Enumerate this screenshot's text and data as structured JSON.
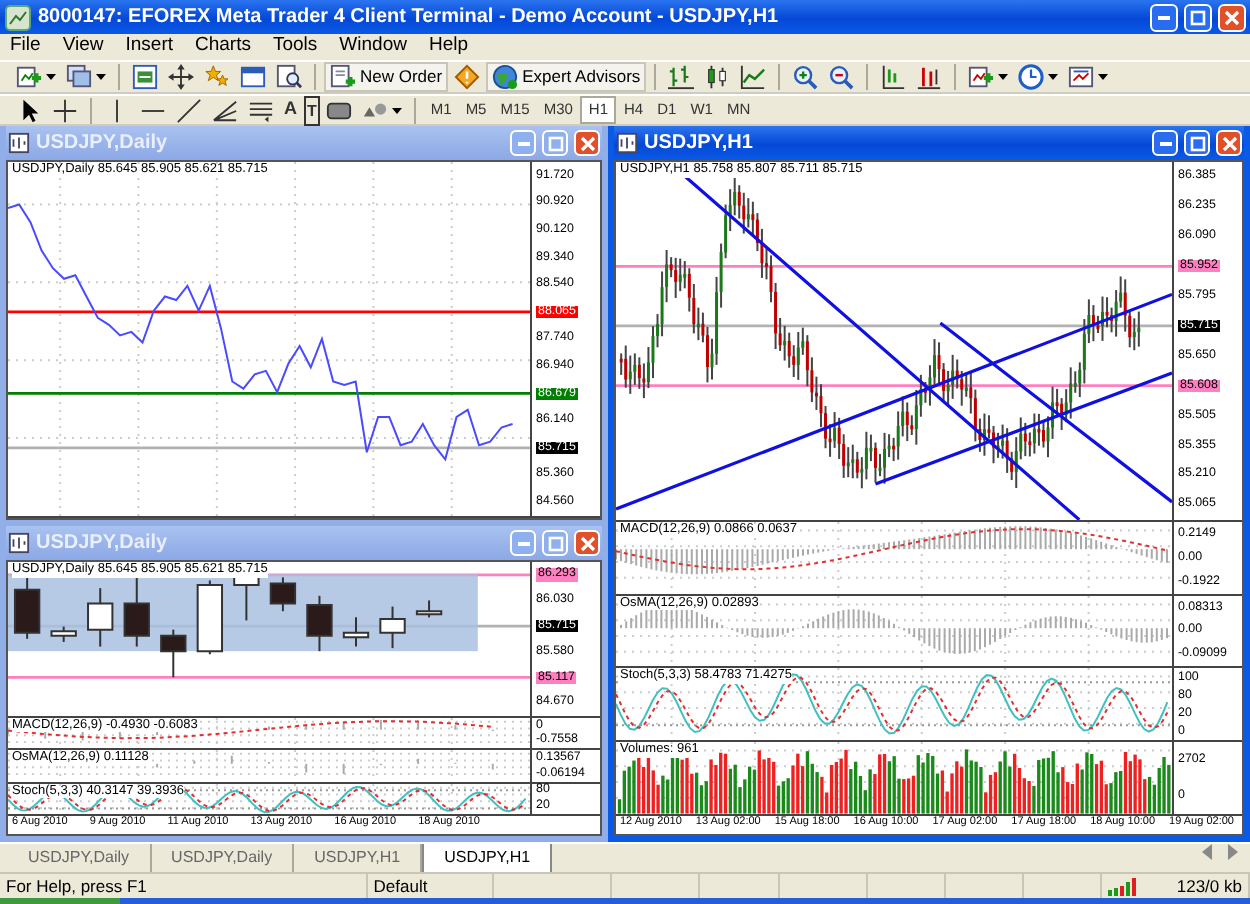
{
  "window": {
    "title": "8000147: EFOREX Meta Trader 4 Client Terminal - Demo Account - USDJPY,H1"
  },
  "menu": [
    "File",
    "View",
    "Insert",
    "Charts",
    "Tools",
    "Window",
    "Help"
  ],
  "toolbar": [
    {
      "kind": "new-chart"
    },
    {
      "kind": "profiles"
    },
    {
      "kind": "sep"
    },
    {
      "kind": "market-watch"
    },
    {
      "kind": "navigator"
    },
    {
      "kind": "data-window"
    },
    {
      "kind": "terminal"
    },
    {
      "kind": "tester"
    },
    {
      "kind": "sep"
    },
    {
      "kind": "new-order",
      "label": "New Order"
    },
    {
      "kind": "metaeditor"
    },
    {
      "kind": "expert-advisors",
      "label": "Expert Advisors"
    },
    {
      "kind": "sep"
    },
    {
      "kind": "bar-chart"
    },
    {
      "kind": "candles"
    },
    {
      "kind": "line-chart"
    },
    {
      "kind": "sep"
    },
    {
      "kind": "zoom-in"
    },
    {
      "kind": "zoom-out"
    },
    {
      "kind": "sep"
    },
    {
      "kind": "chart-shift"
    },
    {
      "kind": "autoscroll"
    },
    {
      "kind": "sep"
    },
    {
      "kind": "indicators"
    },
    {
      "kind": "periods"
    },
    {
      "kind": "templates"
    }
  ],
  "line_studies": [
    {
      "kind": "cursor"
    },
    {
      "kind": "crosshair"
    },
    {
      "kind": "sep"
    },
    {
      "kind": "vline"
    },
    {
      "kind": "hline"
    },
    {
      "kind": "trendline"
    },
    {
      "kind": "fibo"
    },
    {
      "kind": "channel"
    },
    {
      "kind": "text",
      "label": "A"
    },
    {
      "kind": "text-label",
      "label": "T"
    },
    {
      "kind": "arrow-sign"
    },
    {
      "kind": "shapes"
    },
    {
      "kind": "sep"
    }
  ],
  "timeframes": [
    {
      "label": "M1",
      "selected": false
    },
    {
      "label": "M5",
      "selected": false
    },
    {
      "label": "M15",
      "selected": false
    },
    {
      "label": "M30",
      "selected": false
    },
    {
      "label": "H1",
      "selected": true
    },
    {
      "label": "H4",
      "selected": false
    },
    {
      "label": "D1",
      "selected": false
    },
    {
      "label": "W1",
      "selected": false
    },
    {
      "label": "MN",
      "selected": false
    }
  ],
  "charts": [
    {
      "title": "USDJPY,Daily",
      "active": false,
      "panes": [
        {
          "kind": "line",
          "header": "USDJPY,Daily  85.645 85.905 85.621 85.715",
          "scale": [
            {
              "kind": "tick",
              "text": "91.720"
            },
            {
              "kind": "tick",
              "text": "90.920"
            },
            {
              "kind": "tick",
              "text": "90.120"
            },
            {
              "kind": "tick",
              "text": "89.340"
            },
            {
              "kind": "tick",
              "text": "88.540"
            },
            {
              "kind": "marker",
              "text": "88.065",
              "color": "#ff0000"
            },
            {
              "kind": "tick",
              "text": "87.740"
            },
            {
              "kind": "tick",
              "text": "86.940"
            },
            {
              "kind": "marker",
              "text": "86.679",
              "color": "#008000"
            },
            {
              "kind": "tick",
              "text": "86.140"
            },
            {
              "kind": "marker",
              "text": "85.715",
              "color": "#000000"
            },
            {
              "kind": "tick",
              "text": "85.360"
            },
            {
              "kind": "tick",
              "text": "84.560"
            }
          ]
        }
      ]
    },
    {
      "title": "USDJPY,Daily",
      "active": false,
      "panes": [
        {
          "kind": "candles",
          "header": "USDJPY,Daily  85.645 85.905 85.621 85.715",
          "scale": [
            {
              "kind": "marker",
              "text": "86.293",
              "color": "#ff80c0"
            },
            {
              "kind": "tick",
              "text": "86.030"
            },
            {
              "kind": "marker",
              "text": "85.715",
              "color": "#000000"
            },
            {
              "kind": "tick",
              "text": "85.580"
            },
            {
              "kind": "marker",
              "text": "85.117",
              "color": "#ff80c0"
            },
            {
              "kind": "tick",
              "text": "84.670"
            }
          ]
        },
        {
          "kind": "macd",
          "header": "MACD(12,26,9) -0.4930 -0.6083",
          "scale": [
            {
              "kind": "tick",
              "text": "0"
            },
            {
              "kind": "tick",
              "text": "-0.7558"
            }
          ]
        },
        {
          "kind": "osma",
          "header": "OsMA(12,26,9) 0.11128",
          "scale": [
            {
              "kind": "tick",
              "text": "0.13567"
            },
            {
              "kind": "tick",
              "text": "-0.06194"
            }
          ]
        },
        {
          "kind": "stoch",
          "header": "Stoch(5,3,3) 40.3147 39.3936",
          "scale": [
            {
              "kind": "tick",
              "text": "80"
            },
            {
              "kind": "tick",
              "text": "20"
            }
          ]
        }
      ],
      "dates": [
        "6 Aug 2010",
        "9 Aug 2010",
        "11 Aug 2010",
        "13 Aug 2010",
        "16 Aug 2010",
        "18 Aug 2010"
      ]
    },
    {
      "title": "USDJPY,H1",
      "active": true,
      "panes": [
        {
          "kind": "candles-h1",
          "header": "USDJPY,H1  85.758 85.807 85.711 85.715",
          "scale": [
            {
              "kind": "tick",
              "text": "86.385"
            },
            {
              "kind": "tick",
              "text": "86.235"
            },
            {
              "kind": "tick",
              "text": "86.090"
            },
            {
              "kind": "marker",
              "text": "85.952",
              "color": "#ff80c0"
            },
            {
              "kind": "tick",
              "text": "85.795"
            },
            {
              "kind": "marker",
              "text": "85.715",
              "color": "#000000"
            },
            {
              "kind": "tick",
              "text": "85.650"
            },
            {
              "kind": "marker",
              "text": "85.608",
              "color": "#ff80c0"
            },
            {
              "kind": "tick",
              "text": "85.505"
            },
            {
              "kind": "tick",
              "text": "85.355"
            },
            {
              "kind": "tick",
              "text": "85.210"
            },
            {
              "kind": "tick",
              "text": "85.065"
            }
          ]
        },
        {
          "kind": "macd",
          "header": "MACD(12,26,9) 0.0866 0.0637",
          "scale": [
            {
              "kind": "tick",
              "text": "0.2149"
            },
            {
              "kind": "tick",
              "text": "0.00"
            },
            {
              "kind": "tick",
              "text": "-0.1922"
            }
          ]
        },
        {
          "kind": "osma",
          "header": "OsMA(12,26,9) 0.02893",
          "scale": [
            {
              "kind": "tick",
              "text": "0.08313"
            },
            {
              "kind": "tick",
              "text": "0.00"
            },
            {
              "kind": "tick",
              "text": "-0.09099"
            }
          ]
        },
        {
          "kind": "stoch",
          "header": "Stoch(5,3,3) 58.4783 71.4275",
          "scale": [
            {
              "kind": "tick",
              "text": "100"
            },
            {
              "kind": "tick",
              "text": "80"
            },
            {
              "kind": "tick",
              "text": "20"
            },
            {
              "kind": "tick",
              "text": "0"
            }
          ]
        },
        {
          "kind": "volumes",
          "header": "Volumes: 961",
          "scale": [
            {
              "kind": "tick",
              "text": "2702"
            },
            {
              "kind": "tick",
              "text": "0"
            }
          ]
        }
      ],
      "dates": [
        "12 Aug 2010",
        "13 Aug 02:00",
        "15 Aug 18:00",
        "16 Aug 10:00",
        "17 Aug 02:00",
        "17 Aug 18:00",
        "18 Aug 10:00",
        "19 Aug 02:00"
      ]
    }
  ],
  "tabs": [
    {
      "label": "USDJPY,Daily",
      "selected": false
    },
    {
      "label": "USDJPY,Daily",
      "selected": false
    },
    {
      "label": "USDJPY,H1",
      "selected": false
    },
    {
      "label": "USDJPY,H1",
      "selected": true
    }
  ],
  "status_bar": {
    "help": "For Help, press F1",
    "profile": "Default",
    "traffic": "123/0 kb"
  }
}
